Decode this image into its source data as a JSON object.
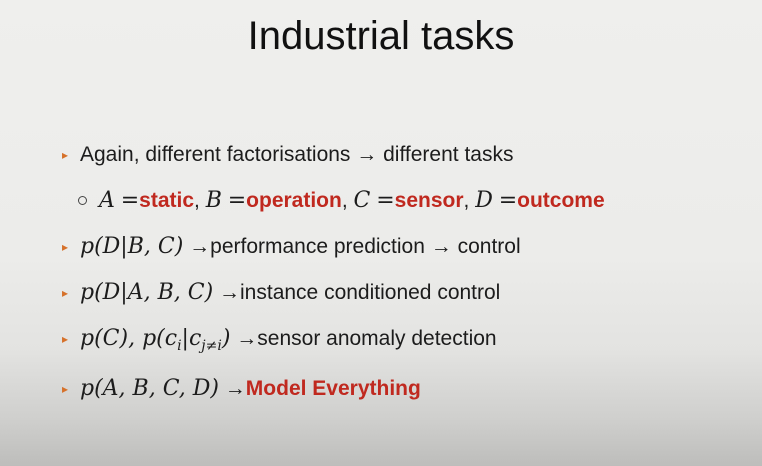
{
  "slide": {
    "title": "Industrial tasks",
    "lines": [
      {
        "prefix": "Again, different factorisations → different tasks"
      },
      {
        "vars": [
          "A",
          "B",
          "C",
          "D"
        ],
        "eq": "=",
        "names": [
          "static",
          "operation",
          "sensor",
          "outcome"
        ],
        "sep": ","
      },
      {
        "math": "p(D|B, C)",
        "text": "→performance prediction → control"
      },
      {
        "math": "p(D|A, B, C)",
        "text": "→instance conditioned control"
      },
      {
        "math_a": "p(C), p(c",
        "sub_i": "i",
        "math_b": "|c",
        "sub_j": "j≠i",
        "math_c": ")",
        "text": "→sensor anomaly detection"
      },
      {
        "math": "p(A, B, C, D)",
        "arrow": "→",
        "emph": "Model Everything"
      }
    ]
  },
  "colors": {
    "accent_red": "#c0291f",
    "bullet_orange": "#d6712a"
  }
}
